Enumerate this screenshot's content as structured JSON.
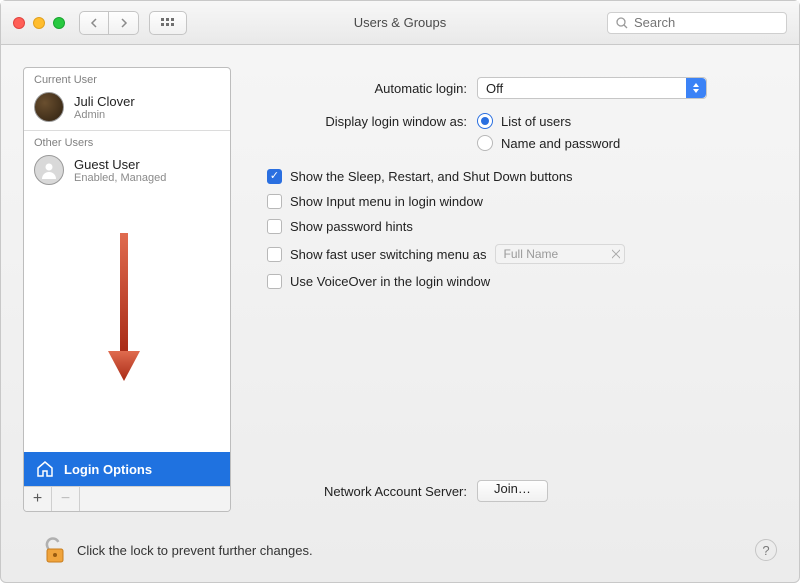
{
  "window": {
    "title": "Users & Groups"
  },
  "search": {
    "placeholder": "Search"
  },
  "sidebar": {
    "sections": {
      "current_label": "Current User",
      "other_label": "Other Users"
    },
    "current_user": {
      "name": "Juli Clover",
      "role": "Admin"
    },
    "other_users": [
      {
        "name": "Guest User",
        "meta": "Enabled, Managed"
      }
    ],
    "login_options": "Login Options",
    "add": "+",
    "remove": "−"
  },
  "pane": {
    "auto_login_label": "Automatic login:",
    "auto_login_value": "Off",
    "display_login_label": "Display login window as:",
    "radio": {
      "list": "List of users",
      "namepwd": "Name and password"
    },
    "checks": {
      "sleep_restart": "Show the Sleep, Restart, and Shut Down buttons",
      "input_menu": "Show Input menu in login window",
      "pwd_hints": "Show password hints",
      "fast_switch": "Show fast user switching menu as",
      "fast_switch_value": "Full Name",
      "voiceover": "Use VoiceOver in the login window"
    },
    "nas_label": "Network Account Server:",
    "join_btn": "Join…"
  },
  "footer": {
    "lock_text": "Click the lock to prevent further changes."
  }
}
